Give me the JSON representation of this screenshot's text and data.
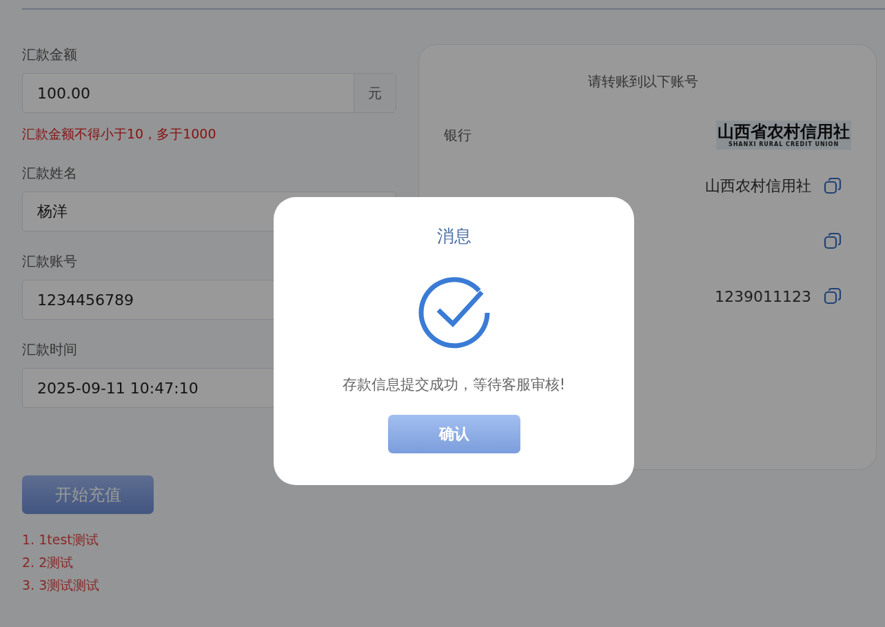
{
  "form": {
    "fields": [
      {
        "label": "汇款金额",
        "value": "100.00",
        "suffix": "元",
        "error": "汇款金额不得小于10，多于1000"
      },
      {
        "label": "汇款姓名",
        "value": "杨洋"
      },
      {
        "label": "汇款账号",
        "value": "1234456789"
      },
      {
        "label": "汇款时间",
        "value": "2025-09-11 10:47:10"
      }
    ],
    "submit_button": "开始充值",
    "notes": [
      "1. 1test测试",
      "2. 2测试",
      "3. 3测试测试"
    ]
  },
  "account_card": {
    "title": "请转账到以下账号",
    "rows": [
      {
        "kind": "logo",
        "label": "银行",
        "logo_name": "山西省农村信用社",
        "logo_subtitle": "SHANXI RURAL CREDIT UNION"
      },
      {
        "kind": "text",
        "value": "山西农村信用社"
      },
      {
        "kind": "text"
      },
      {
        "kind": "text",
        "value": "1239011123"
      }
    ]
  },
  "dialog": {
    "title": "消息",
    "message": "存款信息提交成功，等待客服审核!",
    "confirm_button": "确认"
  }
}
